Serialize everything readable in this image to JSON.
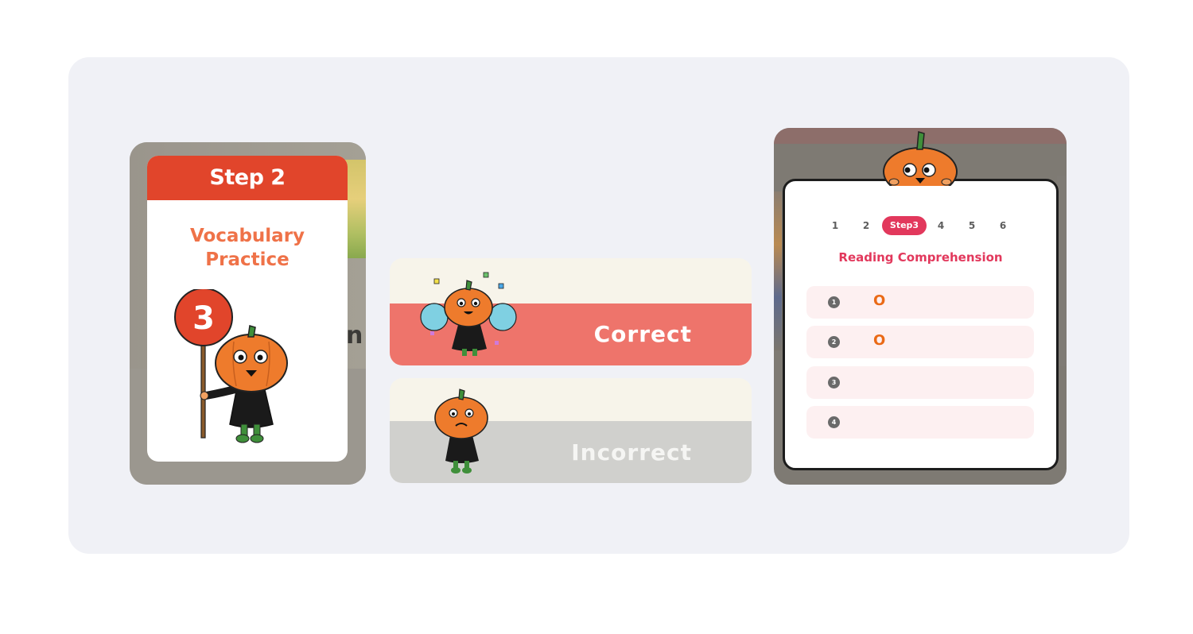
{
  "step_card": {
    "header": "Step 2",
    "title_line1": "Vocabulary",
    "title_line2": "Practice",
    "sign_number": "3",
    "background_letter": "n"
  },
  "feedback": {
    "correct_label": "Correct",
    "incorrect_label": "Incorrect"
  },
  "quiz": {
    "steps": [
      "1",
      "2",
      "Step3",
      "4",
      "5",
      "6"
    ],
    "active_step": "Step3",
    "title": "Reading Comprehension",
    "questions": [
      {
        "number": "1",
        "answer": "O"
      },
      {
        "number": "2",
        "answer": "O"
      },
      {
        "number": "3",
        "answer": ""
      },
      {
        "number": "4",
        "answer": ""
      }
    ]
  },
  "colors": {
    "step_header": "#e1452b",
    "title_orange": "#ef7248",
    "correct_band": "#ee746b",
    "incorrect_band": "#d0d0cd",
    "quiz_accent": "#e2385c",
    "answer_mark": "#ea6a16"
  },
  "icons": [
    "pumpkin-mascot-sign-icon",
    "pumpkin-mascot-cheer-icon",
    "pumpkin-mascot-sad-icon",
    "pumpkin-mascot-peek-icon"
  ]
}
